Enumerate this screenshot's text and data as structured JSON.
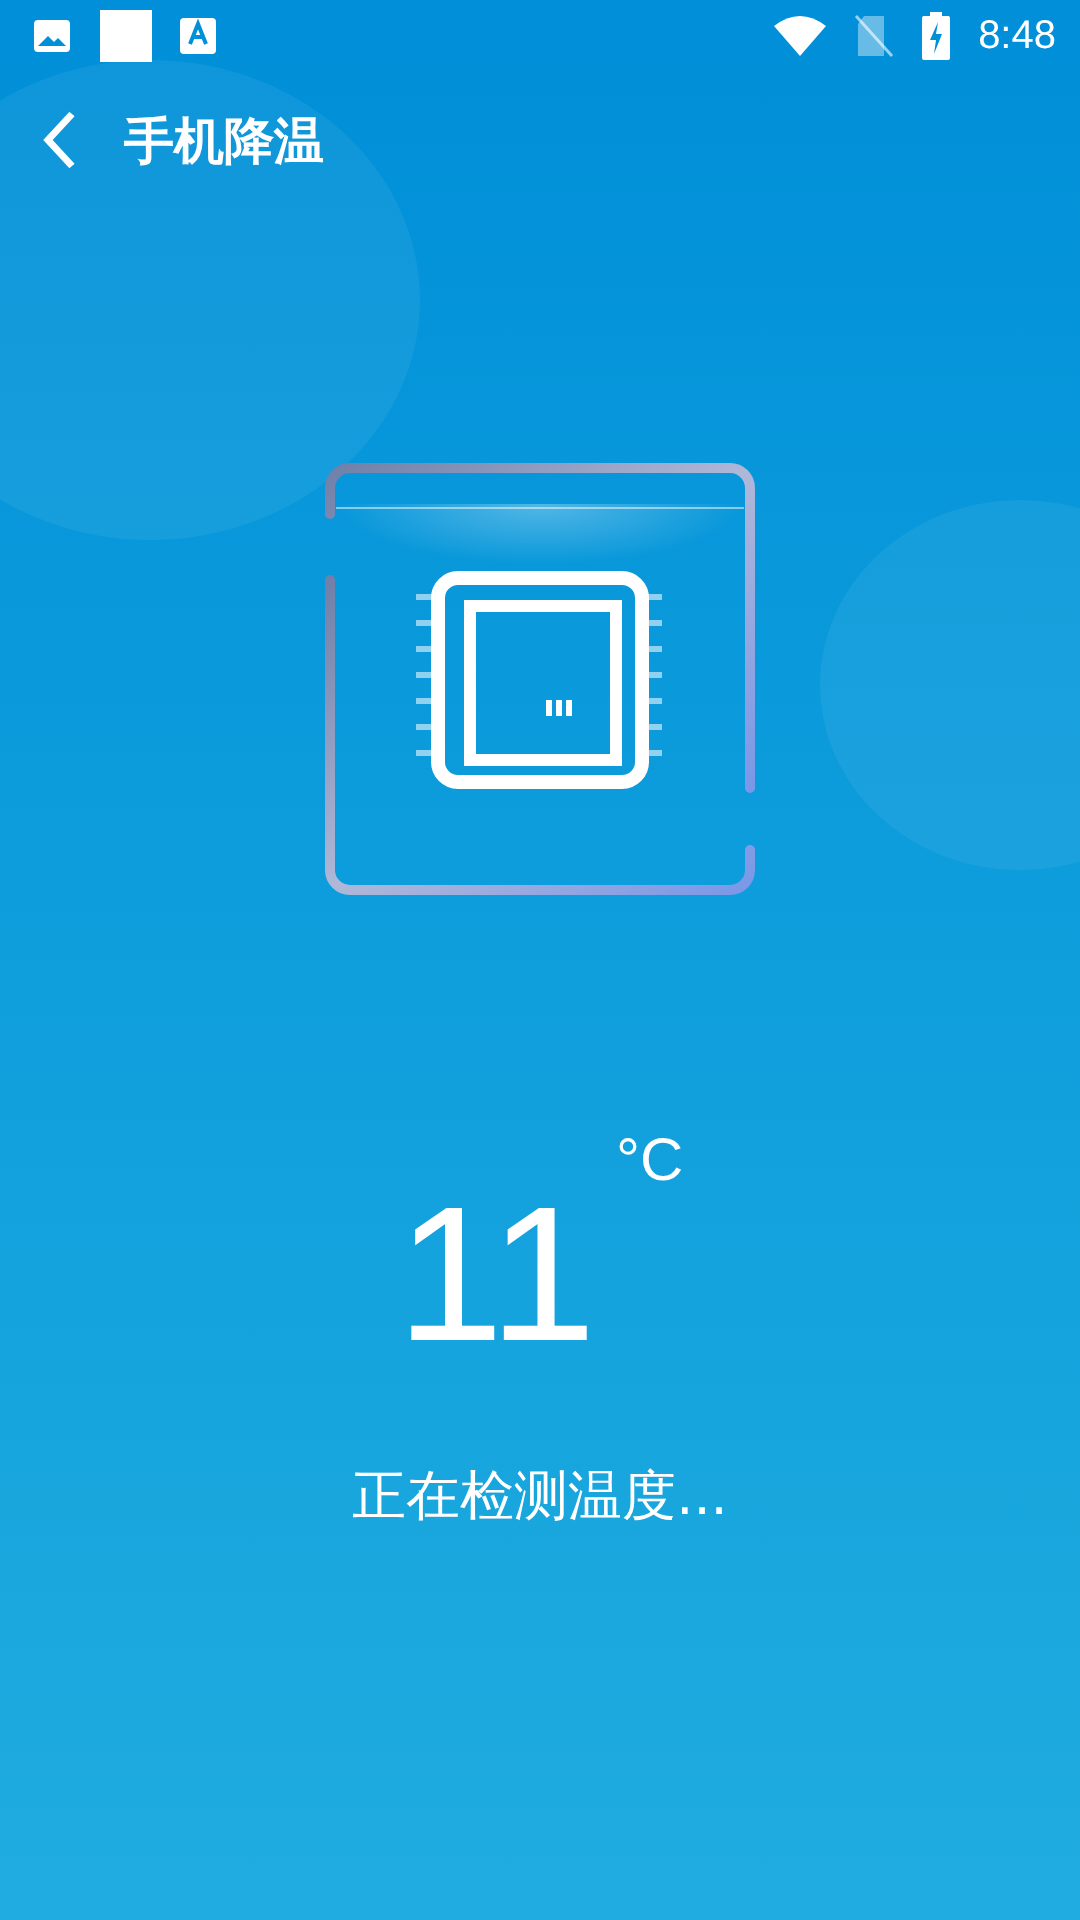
{
  "status_bar": {
    "time": "8:48"
  },
  "header": {
    "title": "手机降温"
  },
  "temperature": {
    "value": "11",
    "unit": "°C"
  },
  "status_text": "正在检测温度..."
}
